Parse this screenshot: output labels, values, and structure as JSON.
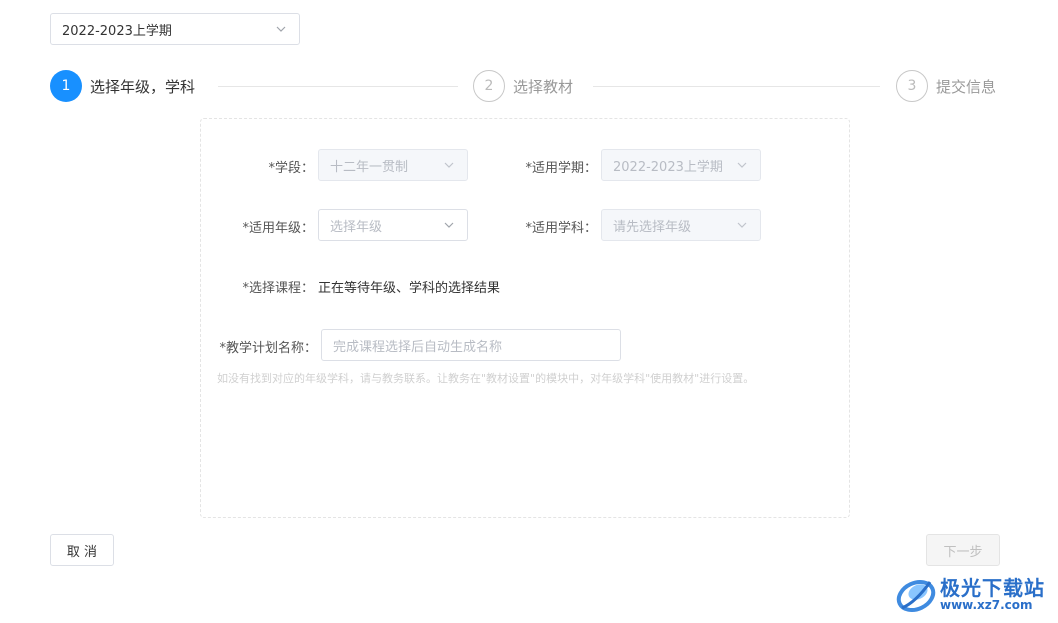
{
  "term_select": {
    "value": "2022-2023上学期"
  },
  "steps": [
    {
      "number": "1",
      "label": "选择年级，学科",
      "state": "active"
    },
    {
      "number": "2",
      "label": "选择教材",
      "state": "idle"
    },
    {
      "number": "3",
      "label": "提交信息",
      "state": "idle"
    }
  ],
  "form": {
    "stage": {
      "label": "*学段：",
      "value": "十二年一贯制"
    },
    "term": {
      "label": "*适用学期：",
      "value": "2022-2023上学期"
    },
    "grade": {
      "label": "*适用年级：",
      "placeholder": "选择年级"
    },
    "subject": {
      "label": "*适用学科：",
      "placeholder": "请先选择年级"
    },
    "course": {
      "label": "*选择课程：",
      "value": "正在等待年级、学科的选择结果"
    },
    "plan_name": {
      "label": "*教学计划名称：",
      "placeholder": "完成课程选择后自动生成名称"
    },
    "hint": "如没有找到对应的年级学科，请与教务联系。让教务在\"教材设置\"的模块中，对年级学科\"使用教材\"进行设置。"
  },
  "buttons": {
    "cancel": "取 消",
    "next": "下一步"
  },
  "watermark": {
    "name": "极光下载站",
    "url": "www.xz7.com"
  },
  "colors": {
    "accent": "#1890ff",
    "watermark": "#2a6fc9"
  },
  "icons": {
    "dropdown": "chevron-down-icon",
    "logo": "aurora-logo-icon"
  }
}
